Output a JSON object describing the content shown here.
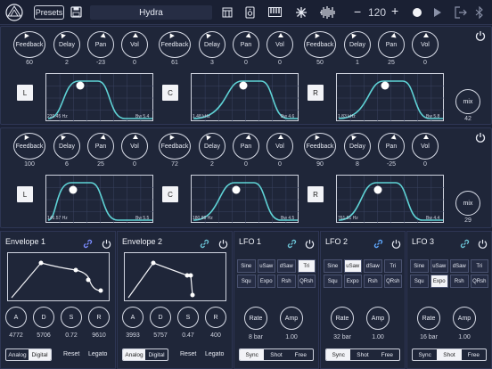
{
  "topbar": {
    "presets_label": "Presets",
    "preset_name": "Hydra",
    "tempo": "120",
    "minus": "−",
    "plus": "+"
  },
  "delay_rows": [
    {
      "channels": [
        {
          "feedback": "60",
          "delay": "2",
          "pan": "-23",
          "vol": "0",
          "side": "L",
          "hz": "239.45 Hz",
          "bw": "Bw 5.4"
        },
        {
          "feedback": "61",
          "delay": "3",
          "pan": "0",
          "vol": "0",
          "side": "C",
          "hz": "1.48 kHz",
          "bw": "Bw 4.6"
        },
        {
          "feedback": "50",
          "delay": "1",
          "pan": "25",
          "vol": "0",
          "side": "R",
          "hz": "1.83 kHz",
          "bw": "Bw 5.8"
        }
      ],
      "mix_label": "mix",
      "mix": "42"
    },
    {
      "channels": [
        {
          "feedback": "100",
          "delay": "6",
          "pan": "25",
          "vol": "0",
          "side": "L",
          "hz": "146.57 Hz",
          "bw": "Bw 5.5"
        },
        {
          "feedback": "72",
          "delay": "2",
          "pan": "0",
          "vol": "0",
          "side": "C",
          "hz": "180.88 Hz",
          "bw": "Bw 4.5"
        },
        {
          "feedback": "90",
          "delay": "8",
          "pan": "-25",
          "vol": "0",
          "side": "R",
          "hz": "761.51 Hz",
          "bw": "Bw 4.4"
        }
      ],
      "mix_label": "mix",
      "mix": "29"
    }
  ],
  "knob_labels": {
    "feedback": "Feedback",
    "delay": "Delay",
    "pan": "Pan",
    "vol": "Vol"
  },
  "envelopes": [
    {
      "title": "Envelope 1",
      "a": "4772",
      "d": "5706",
      "s": "0.72",
      "r": "9610",
      "mode": "Digital"
    },
    {
      "title": "Envelope 2",
      "a": "3993",
      "d": "5757",
      "s": "0.47",
      "r": "400",
      "mode": "Analog"
    }
  ],
  "adsr_labels": {
    "a": "A",
    "d": "D",
    "s": "S",
    "r": "R"
  },
  "env_buttons": {
    "analog": "Analog",
    "digital": "Digital",
    "reset": "Reset",
    "legato": "Legato"
  },
  "lfos": [
    {
      "title": "LFO 1",
      "rate": "8 bar",
      "amp": "1.00",
      "active_shape": "Tri",
      "sync": "Sync"
    },
    {
      "title": "LFO 2",
      "rate": "32 bar",
      "amp": "1.00",
      "active_shape": "uSaw",
      "sync": "Sync"
    },
    {
      "title": "LFO 3",
      "rate": "16 bar",
      "amp": "1.00",
      "active_shape": "Expo",
      "sync": "Shot"
    }
  ],
  "lfo_shapes": [
    "Sine",
    "uSaw",
    "dSaw",
    "Tri",
    "Squ",
    "Expo",
    "Rsh",
    "QRsh"
  ],
  "lfo_labels": {
    "rate": "Rate",
    "amp": "Amp"
  },
  "sync_modes": [
    "Sync",
    "Shot",
    "Free"
  ]
}
